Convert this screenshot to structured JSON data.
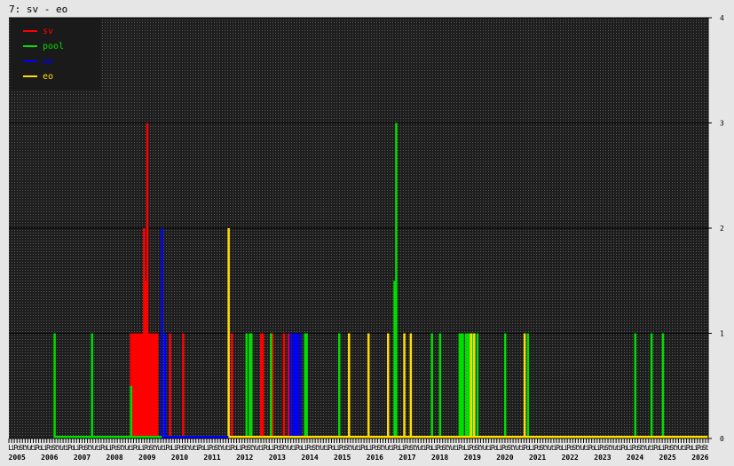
{
  "header": {
    "title": "7: sv - eo"
  },
  "chart_data": {
    "type": "bar",
    "title": "7: sv - eo",
    "xlim": [
      2005.25,
      2026.75
    ],
    "ylim": [
      0,
      4
    ],
    "yticks": [
      "0",
      "1",
      "2",
      "3",
      "4"
    ],
    "grid": true,
    "legend_position": "top-left",
    "year_labels": [
      "2005",
      "2006",
      "2007",
      "2008",
      "2009",
      "2010",
      "2011",
      "2012",
      "2013",
      "2014",
      "2015",
      "2016",
      "2017",
      "2018",
      "2019",
      "2020",
      "2021",
      "2022",
      "2023",
      "2024",
      "2025",
      "2026"
    ],
    "month_tick_pattern": [
      "L",
      "i",
      "P",
      "o",
      "S",
      "t",
      "Y",
      "u",
      "t",
      "i",
      "P",
      "o"
    ],
    "series": [
      {
        "name": "sv",
        "color": "#ff0000",
        "points": [
          [
            2009.0,
            1
          ],
          [
            2009.05,
            1
          ],
          [
            2009.1,
            1
          ],
          [
            2009.15,
            1
          ],
          [
            2009.2,
            1
          ],
          [
            2009.25,
            1
          ],
          [
            2009.3,
            1
          ],
          [
            2009.35,
            1
          ],
          [
            2009.4,
            2
          ],
          [
            2009.45,
            1.5
          ],
          [
            2009.5,
            3
          ],
          [
            2009.55,
            1
          ],
          [
            2009.6,
            1
          ],
          [
            2009.65,
            1
          ],
          [
            2009.7,
            1
          ],
          [
            2009.75,
            1
          ],
          [
            2009.8,
            1
          ],
          [
            2010.2,
            1
          ],
          [
            2010.6,
            1
          ],
          [
            2012.1,
            1
          ],
          [
            2013.0,
            1
          ],
          [
            2013.05,
            1
          ],
          [
            2013.3,
            1
          ],
          [
            2013.35,
            1
          ],
          [
            2013.7,
            1
          ],
          [
            2013.85,
            1
          ]
        ]
      },
      {
        "name": "pool",
        "color": "#00dd00",
        "points": [
          [
            2006.65,
            1
          ],
          [
            2007.8,
            1
          ],
          [
            2009.0,
            0.5
          ],
          [
            2012.55,
            1
          ],
          [
            2012.65,
            1
          ],
          [
            2012.7,
            1
          ],
          [
            2013.3,
            1
          ],
          [
            2014.35,
            1
          ],
          [
            2014.4,
            1
          ],
          [
            2015.4,
            1
          ],
          [
            2017.1,
            1.5
          ],
          [
            2017.15,
            3
          ],
          [
            2018.25,
            1
          ],
          [
            2018.5,
            1
          ],
          [
            2019.1,
            1
          ],
          [
            2019.15,
            1
          ],
          [
            2019.2,
            1
          ],
          [
            2019.3,
            1
          ],
          [
            2019.35,
            1
          ],
          [
            2019.4,
            1
          ],
          [
            2019.5,
            1
          ],
          [
            2019.65,
            1
          ],
          [
            2020.5,
            1
          ],
          [
            2021.2,
            1
          ],
          [
            2024.5,
            1
          ],
          [
            2025.0,
            1
          ],
          [
            2025.35,
            1
          ]
        ]
      },
      {
        "name": "eo",
        "color": "#0000ff",
        "points": [
          [
            2009.95,
            2
          ],
          [
            2010.05,
            1
          ],
          [
            2013.9,
            1
          ],
          [
            2014.0,
            1
          ],
          [
            2014.05,
            1
          ],
          [
            2014.1,
            1
          ],
          [
            2014.2,
            1
          ]
        ]
      },
      {
        "name": "eo",
        "color": "#ffdd00",
        "points": [
          [
            2012.0,
            2
          ],
          [
            2015.7,
            1
          ],
          [
            2016.3,
            1
          ],
          [
            2016.9,
            1
          ],
          [
            2017.4,
            1
          ],
          [
            2017.6,
            1
          ],
          [
            2019.45,
            1
          ],
          [
            2019.55,
            1
          ],
          [
            2021.1,
            1
          ]
        ]
      }
    ]
  }
}
